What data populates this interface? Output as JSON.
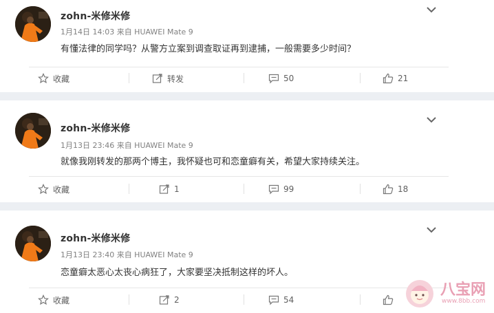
{
  "posts": [
    {
      "username": "zohn-米修米修",
      "meta": "1月14日 14:03 来自 HUAWEI Mate 9",
      "content": "有懂法律的同学吗？从警方立案到调查取证再到逮捕，一般需要多少时间？",
      "actions": {
        "favorite": "收藏",
        "repost": "转发",
        "comment": "50",
        "like": "21"
      }
    },
    {
      "username": "zohn-米修米修",
      "meta": "1月13日 23:46 来自 HUAWEI Mate 9",
      "content": "就像我刚转发的那两个博主，我怀疑也可和恋童癖有关，希望大家持续关注。",
      "actions": {
        "favorite": "收藏",
        "repost": "1",
        "comment": "99",
        "like": "18"
      }
    },
    {
      "username": "zohn-米修米修",
      "meta": "1月13日 23:40 来自 HUAWEI Mate 9",
      "content": "恋童癖太恶心太丧心病狂了，大家要坚决抵制这样的坏人。",
      "actions": {
        "favorite": "收藏",
        "repost": "2",
        "comment": "54",
        "like": ""
      }
    }
  ],
  "watermark": {
    "text": "八宝网",
    "url": "www.8bb.com"
  },
  "colors": {
    "separator": "#eceff3",
    "text": "#333333",
    "meta": "#808080",
    "watermark": "#e9a0b4"
  }
}
